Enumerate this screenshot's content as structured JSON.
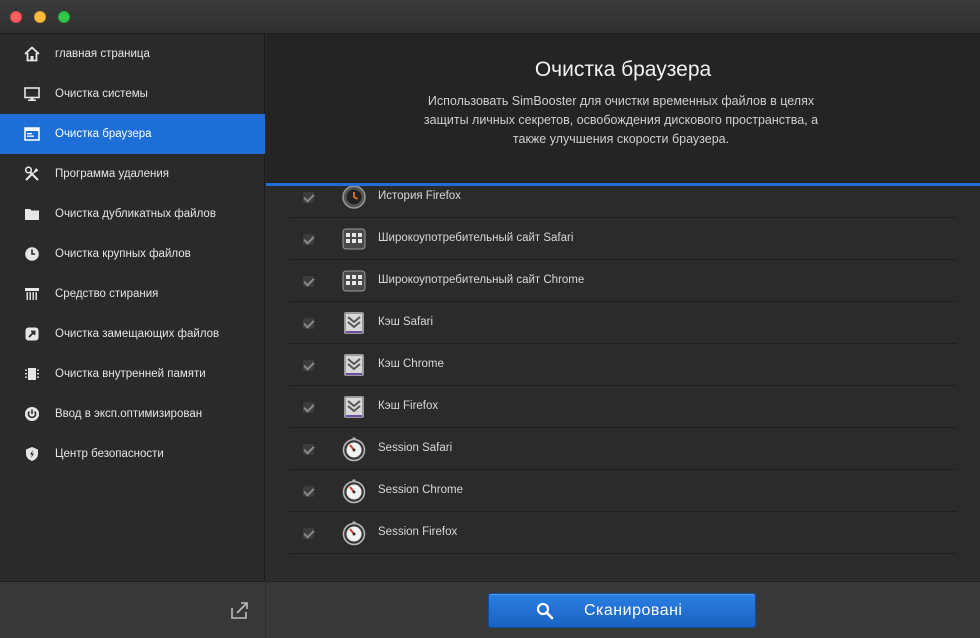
{
  "window": {
    "traffic_lights": [
      "close",
      "minimize",
      "maximize"
    ]
  },
  "sidebar": {
    "items": [
      {
        "label": "главная страница",
        "icon": "home-icon"
      },
      {
        "label": "Очистка системы",
        "icon": "monitor-icon"
      },
      {
        "label": "Очистка браузера",
        "icon": "browser-icon",
        "active": true
      },
      {
        "label": "Программа удаления",
        "icon": "tools-icon"
      },
      {
        "label": "Очистка дубликатных файлов",
        "icon": "folder-icon"
      },
      {
        "label": "Очистка крупных файлов",
        "icon": "clock-icon"
      },
      {
        "label": "Средство стирания",
        "icon": "shredder-icon"
      },
      {
        "label": "Очистка замещающих файлов",
        "icon": "alias-icon"
      },
      {
        "label": "Очистка внутренней памяти",
        "icon": "memory-icon"
      },
      {
        "label": "Ввод в эксп.оптимизирован",
        "icon": "power-icon"
      },
      {
        "label": "Центр безопасности",
        "icon": "shield-icon"
      }
    ],
    "footer_icon": "share-icon"
  },
  "header": {
    "title": "Очистка браузера",
    "description": "Использовать SimBooster для очистки временных файлов в целях защиты личных секретов, освобождения дискового пространства, а также улучшения скорости браузера."
  },
  "list": {
    "items": [
      {
        "label": "История Firefox",
        "icon": "history-icon",
        "checked": true
      },
      {
        "label": "Широкоупотребительный сайт Safari",
        "icon": "top-sites-icon",
        "checked": true
      },
      {
        "label": "Широкоупотребительный сайт Chrome",
        "icon": "top-sites-icon",
        "checked": true
      },
      {
        "label": "Кэш Safari",
        "icon": "cache-icon",
        "checked": true
      },
      {
        "label": "Кэш Chrome",
        "icon": "cache-icon",
        "checked": true
      },
      {
        "label": "Кэш Firefox",
        "icon": "cache-icon",
        "checked": true
      },
      {
        "label": "Session Safari",
        "icon": "session-icon",
        "checked": true
      },
      {
        "label": "Session Chrome",
        "icon": "session-icon",
        "checked": true
      },
      {
        "label": "Session Firefox",
        "icon": "session-icon",
        "checked": true
      }
    ]
  },
  "footer": {
    "scan_label": "Сканировані",
    "scan_icon": "search-icon"
  },
  "colors": {
    "accent": "#1d6ed6",
    "background": "#2b2b2b",
    "header_bg": "#242424"
  }
}
